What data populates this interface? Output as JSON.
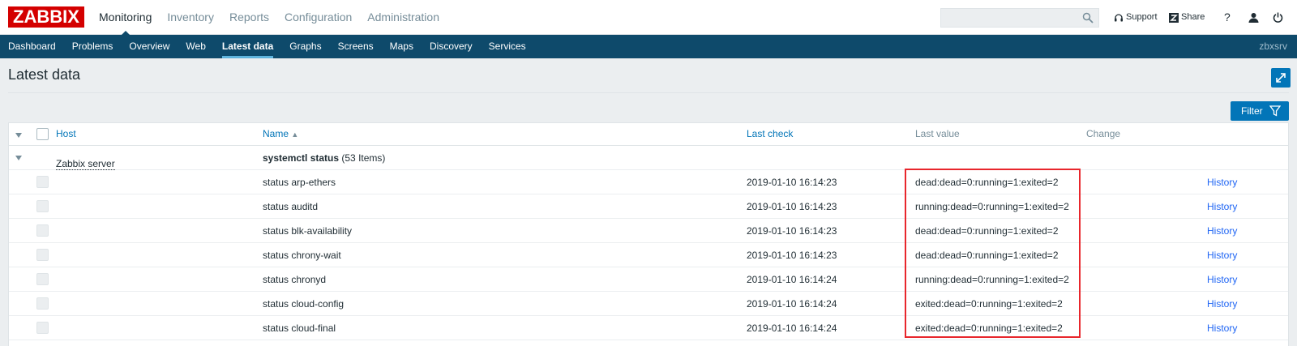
{
  "logo": "ZABBIX",
  "main_menu": [
    {
      "label": "Monitoring",
      "active": true
    },
    {
      "label": "Inventory",
      "active": false
    },
    {
      "label": "Reports",
      "active": false
    },
    {
      "label": "Configuration",
      "active": false
    },
    {
      "label": "Administration",
      "active": false
    }
  ],
  "search": {
    "placeholder": "",
    "value": ""
  },
  "topbar_right": {
    "support": "Support",
    "share": "Share",
    "help": "?"
  },
  "sub_menu": [
    {
      "label": "Dashboard",
      "active": false
    },
    {
      "label": "Problems",
      "active": false
    },
    {
      "label": "Overview",
      "active": false
    },
    {
      "label": "Web",
      "active": false
    },
    {
      "label": "Latest data",
      "active": true
    },
    {
      "label": "Graphs",
      "active": false
    },
    {
      "label": "Screens",
      "active": false
    },
    {
      "label": "Maps",
      "active": false
    },
    {
      "label": "Discovery",
      "active": false
    },
    {
      "label": "Services",
      "active": false
    }
  ],
  "server_name": "zbxsrv",
  "page": {
    "title": "Latest data",
    "filter_label": "Filter"
  },
  "table": {
    "headers": {
      "host": "Host",
      "name": "Name",
      "sort_indicator": "▲",
      "last_check": "Last check",
      "last_value": "Last value",
      "change": "Change"
    },
    "group": {
      "host": "Zabbix server",
      "app_name": "systemctl status",
      "item_count": "(53 Items)"
    },
    "rows": [
      {
        "name": "status arp-ethers",
        "last_check": "2019-01-10 16:14:23",
        "last_value": "dead:dead=0:running=1:exited=2",
        "action": "History"
      },
      {
        "name": "status auditd",
        "last_check": "2019-01-10 16:14:23",
        "last_value": "running:dead=0:running=1:exited=2",
        "action": "History"
      },
      {
        "name": "status blk-availability",
        "last_check": "2019-01-10 16:14:23",
        "last_value": "dead:dead=0:running=1:exited=2",
        "action": "History"
      },
      {
        "name": "status chrony-wait",
        "last_check": "2019-01-10 16:14:23",
        "last_value": "dead:dead=0:running=1:exited=2",
        "action": "History"
      },
      {
        "name": "status chronyd",
        "last_check": "2019-01-10 16:14:24",
        "last_value": "running:dead=0:running=1:exited=2",
        "action": "History"
      },
      {
        "name": "status cloud-config",
        "last_check": "2019-01-10 16:14:24",
        "last_value": "exited:dead=0:running=1:exited=2",
        "action": "History"
      },
      {
        "name": "status cloud-final",
        "last_check": "2019-01-10 16:14:24",
        "last_value": "exited:dead=0:running=1:exited=2",
        "action": "History"
      }
    ]
  },
  "colors": {
    "brand": "#d40000",
    "nav_bg": "#0e4a6b",
    "accent": "#0275b8",
    "highlight_box": "#e8262c"
  }
}
